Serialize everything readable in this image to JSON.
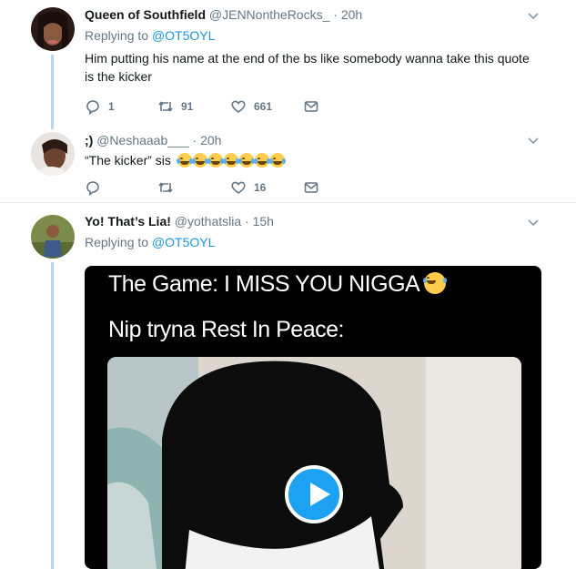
{
  "tweets": [
    {
      "display_name": "Queen of Southfield",
      "handle": "@JENNontheRocks_",
      "separator": "·",
      "time": "20h",
      "replying_prefix": "Replying to",
      "replying_to": "@OT5OYL",
      "text": "Him putting his name at the end of the bs like somebody wanna take this quote is the kicker",
      "replies": "1",
      "retweets": "91",
      "likes": "661"
    },
    {
      "display_name": ";)",
      "handle": "@Neshaaab___",
      "separator": "·",
      "time": "20h",
      "text": "“The kicker” sis",
      "emoji_count": 7,
      "replies": "",
      "retweets": "",
      "likes": "16"
    },
    {
      "display_name": "Yo! That’s Lia!",
      "handle": "@yothatslia",
      "separator": "·",
      "time": "15h",
      "replying_prefix": "Replying to",
      "replying_to": "@OT5OYL",
      "media": {
        "line1": "The Game: I MISS YOU NIGGA",
        "line2": "Nip tryna Rest In Peace:"
      }
    }
  ],
  "icons": {
    "reply": "reply-icon",
    "retweet": "retweet-icon",
    "like": "heart-icon",
    "dm": "envelope-icon",
    "caret": "chevron-down-icon",
    "play": "play-icon"
  },
  "colors": {
    "link": "#1b95e0",
    "muted": "#657786",
    "thread_line": "#b5d9f2",
    "play_button": "#1da1f2"
  }
}
